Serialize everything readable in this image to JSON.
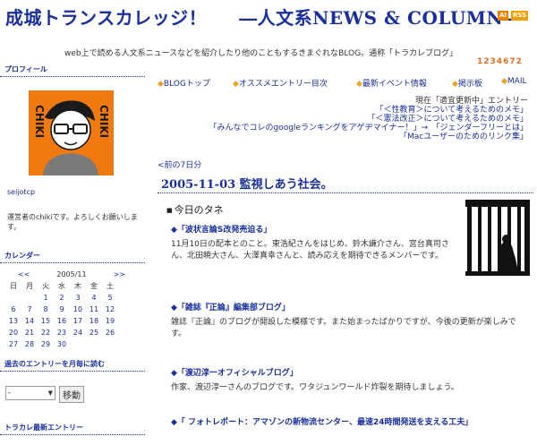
{
  "header": {
    "title_left": "成城トランスカレッジ！",
    "title_right": "―人文系NEWS & COLUMN―",
    "badge_ai": "AI",
    "badge_rss": "RSS",
    "tagline": "web上で読める人文系ニュースなどを紹介したり他のこともするきまぐれなBLOG。通称「トラカレブログ」",
    "counter": [
      "1",
      "2",
      "3",
      "4",
      "6",
      "7",
      "2"
    ]
  },
  "sidebar": {
    "profile_heading": "プロフィール",
    "avatar_text": "CHIKI",
    "user_link": "seijotcp",
    "description": "運営者のchikiです。よろしくお願いします。",
    "calendar_heading": "カレンダー",
    "calendar_prev": "<<",
    "calendar_month": "2005/11",
    "calendar_next": ">>",
    "weekdays": [
      "日",
      "月",
      "火",
      "水",
      "木",
      "金",
      "土"
    ],
    "weeks": [
      [
        "",
        "",
        "1",
        "2",
        "3",
        "4",
        "5"
      ],
      [
        "6",
        "7",
        "8",
        "9",
        "10",
        "11",
        "12"
      ],
      [
        "13",
        "14",
        "15",
        "16",
        "17",
        "18",
        "19"
      ],
      [
        "20",
        "21",
        "22",
        "23",
        "24",
        "25",
        "26"
      ],
      [
        "27",
        "28",
        "29",
        "30",
        "",
        "",
        ""
      ]
    ],
    "archive_heading": "過去のエントリーを月毎に読む",
    "archive_select": "-",
    "archive_button": "移動",
    "recent_heading": "トラカレ最新エントリー"
  },
  "menu": {
    "items": [
      "BLOGトップ",
      "オススメエントリー目次",
      "最新イベント情報",
      "掲示板",
      "MAIL"
    ]
  },
  "pickups": {
    "label": "現在「適宜更新中」エントリー",
    "links": [
      "「＜性教育＞について考えるためのメモ」",
      "「＜憲法改正＞について考えるためのメモ」",
      "「みんなでコレのgoogleランキングをアゲヂマイナー！」→　「ジェンダーフリーとは」",
      "「Macユーザーのためのリンク集」"
    ]
  },
  "main": {
    "prev_link": "<前の7日分",
    "entry_title": "2005-11-03  監視しあう社会。",
    "section_title": "今日のタネ",
    "items": [
      {
        "title": "「波状言論S改発売迫る」",
        "body": "11月10日の配本とのこと。東浩紀さんをはじめ、鈴木謙介さん、宮台真司さん、北田暁大さん、大澤真幸さんと、読み応えを期待できるメンバーです。"
      },
      {
        "title": "「雑誌『正論』編集部ブログ」",
        "body": "雑誌『正論』のブログが開設した模様です。また始まったばかりですが、今後の更新が楽しみです。"
      },
      {
        "title": "「渡辺淳一オフィシャルブログ」",
        "body": "作家、渡辺淳一さんのブログです。ワタジュンワールド炸裂を期待しましょう。"
      },
      {
        "title": "「 フォトレポート：アマゾンの新物流センター、最速24時間発送を支える工夫」",
        "body": ""
      }
    ]
  }
}
